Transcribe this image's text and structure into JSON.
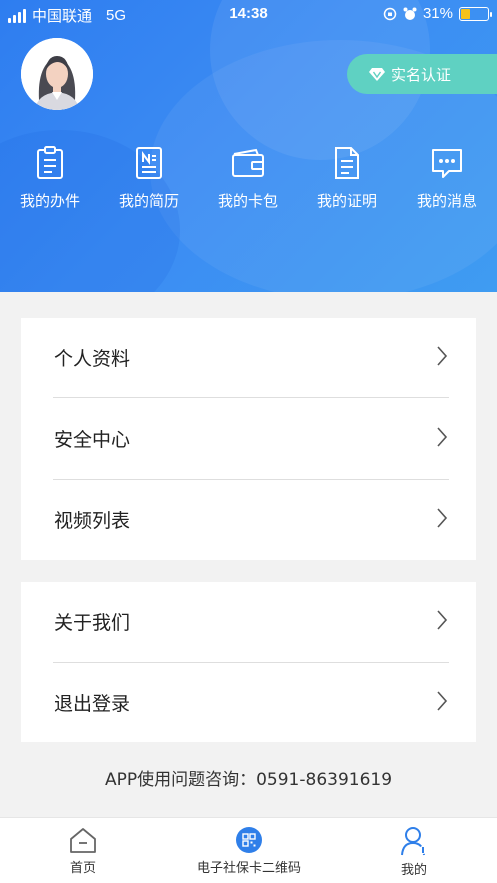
{
  "status_bar": {
    "carrier": "中国联通",
    "network": "5G",
    "time": "14:38",
    "battery": "31%"
  },
  "profile": {
    "avatar_icon": "female-avatar",
    "auth_button": "实名认证",
    "auth_icon": "diamond-icon"
  },
  "quick_actions": [
    {
      "label": "我的办件",
      "icon": "clipboard-list-icon"
    },
    {
      "label": "我的简历",
      "icon": "resume-icon"
    },
    {
      "label": "我的卡包",
      "icon": "wallet-icon"
    },
    {
      "label": "我的证明",
      "icon": "document-icon"
    },
    {
      "label": "我的消息",
      "icon": "message-icon"
    }
  ],
  "menu_group1": [
    {
      "label": "个人资料"
    },
    {
      "label": "安全中心"
    },
    {
      "label": "视频列表"
    }
  ],
  "menu_group2": [
    {
      "label": "关于我们"
    },
    {
      "label": "退出登录"
    }
  ],
  "hotline": "APP使用问题咨询：0591-86391619",
  "tabbar": [
    {
      "label": "首页",
      "icon": "home-icon"
    },
    {
      "label": "电子社保卡二维码",
      "icon": "qrcode-icon"
    },
    {
      "label": "我的",
      "icon": "user-icon"
    }
  ],
  "colors": {
    "header_gradient_start": "#2e7df0",
    "header_gradient_end": "#3f9cf2",
    "auth_button": "#5fd1c2",
    "tab_active": "#2f7fe9",
    "battery_fill": "#f4c21b"
  }
}
